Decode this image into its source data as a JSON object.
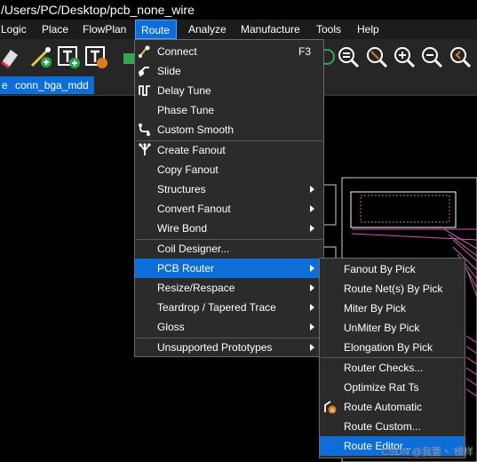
{
  "window": {
    "title": "/Users/PC/Desktop/pcb_none_wire"
  },
  "menubar": {
    "items": [
      "Logic",
      "Place",
      "FlowPlan",
      "Route",
      "Analyze",
      "Manufacture",
      "Tools",
      "Help"
    ],
    "active": "Route"
  },
  "tabs": {
    "left_partial": "e",
    "active": "conn_bga_mdd"
  },
  "route_menu": {
    "items": [
      {
        "label": "Connect",
        "shortcut": "F3"
      },
      {
        "label": "Slide"
      },
      {
        "label": "Delay Tune"
      },
      {
        "label": "Phase Tune"
      },
      {
        "label": "Custom Smooth"
      },
      {
        "label": "Create Fanout"
      },
      {
        "label": "Copy Fanout"
      },
      {
        "label": "Structures"
      },
      {
        "label": "Convert Fanout"
      },
      {
        "label": "Wire Bond"
      },
      {
        "label": "Coil Designer..."
      },
      {
        "label": "PCB Router"
      },
      {
        "label": "Resize/Respace"
      },
      {
        "label": "Teardrop / Tapered Trace"
      },
      {
        "label": "Gloss"
      },
      {
        "label": "Unsupported Prototypes"
      }
    ]
  },
  "pcb_router_submenu": {
    "items": [
      {
        "label": "Fanout By Pick"
      },
      {
        "label": "Route Net(s) By Pick"
      },
      {
        "label": "Miter By Pick"
      },
      {
        "label": "UnMiter By Pick"
      },
      {
        "label": "Elongation By Pick"
      },
      {
        "label": "Router Checks..."
      },
      {
        "label": "Optimize Rat Ts"
      },
      {
        "label": "Route Automatic"
      },
      {
        "label": "Route Custom..."
      },
      {
        "label": "Route Editor..."
      }
    ]
  },
  "watermark": "CSDN @我要丶 榜样",
  "colors": {
    "accent": "#0d6ed9",
    "menu_bg": "#2b2b2b",
    "trace_pink": "#ff66cc"
  }
}
